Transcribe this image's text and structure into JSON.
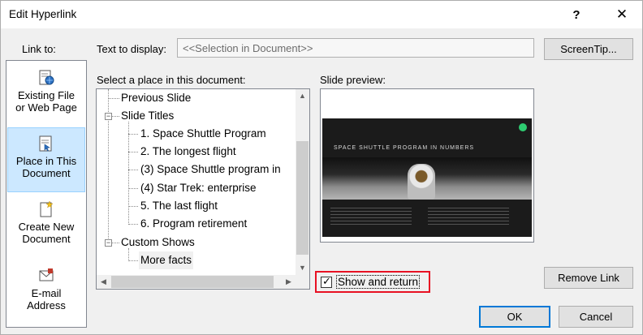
{
  "window": {
    "title": "Edit Hyperlink",
    "help_glyph": "?",
    "close_glyph": "✕"
  },
  "link_to": {
    "label": "Link to:",
    "items": [
      {
        "line1": "Existing File",
        "line2": "or Web Page",
        "icon": "existing-file-web-page-icon",
        "selected": false
      },
      {
        "line1": "Place in This",
        "line2": "Document",
        "icon": "place-in-document-icon",
        "selected": true
      },
      {
        "line1": "Create New",
        "line2": "Document",
        "icon": "create-new-document-icon",
        "selected": false
      },
      {
        "line1": "E-mail",
        "line2": "Address",
        "icon": "email-address-icon",
        "selected": false
      }
    ]
  },
  "text_to_display": {
    "label": "Text to display:",
    "value": "<<Selection in Document>>"
  },
  "buttons": {
    "screentip": "ScreenTip...",
    "remove_link": "Remove Link",
    "ok": "OK",
    "cancel": "Cancel"
  },
  "place_tree": {
    "label": "Select a place in this document:",
    "items": [
      {
        "text": "Previous Slide"
      },
      {
        "text": "Slide Titles"
      },
      {
        "text": "1. Space Shuttle Program"
      },
      {
        "text": "2. The longest flight"
      },
      {
        "text": "(3) Space Shuttle program in"
      },
      {
        "text": "(4) Star Trek: enterprise"
      },
      {
        "text": "5. The last flight"
      },
      {
        "text": "6. Program retirement"
      },
      {
        "text": "Custom Shows"
      },
      {
        "text": "More facts"
      }
    ],
    "selected": "More facts",
    "expander_glyph": "−",
    "scroll_up": "▲",
    "scroll_down": "▼",
    "scroll_left": "◀",
    "scroll_right": "▶"
  },
  "preview": {
    "label": "Slide preview:",
    "slide_title": "SPACE SHUTTLE PROGRAM IN NUMBERS"
  },
  "show_and_return": {
    "label": "Show and return",
    "checked": true,
    "check_glyph": "✓"
  },
  "colors": {
    "selection_bg": "#cce8ff",
    "highlight_border": "#e81123",
    "default_button_border": "#0078d7"
  }
}
